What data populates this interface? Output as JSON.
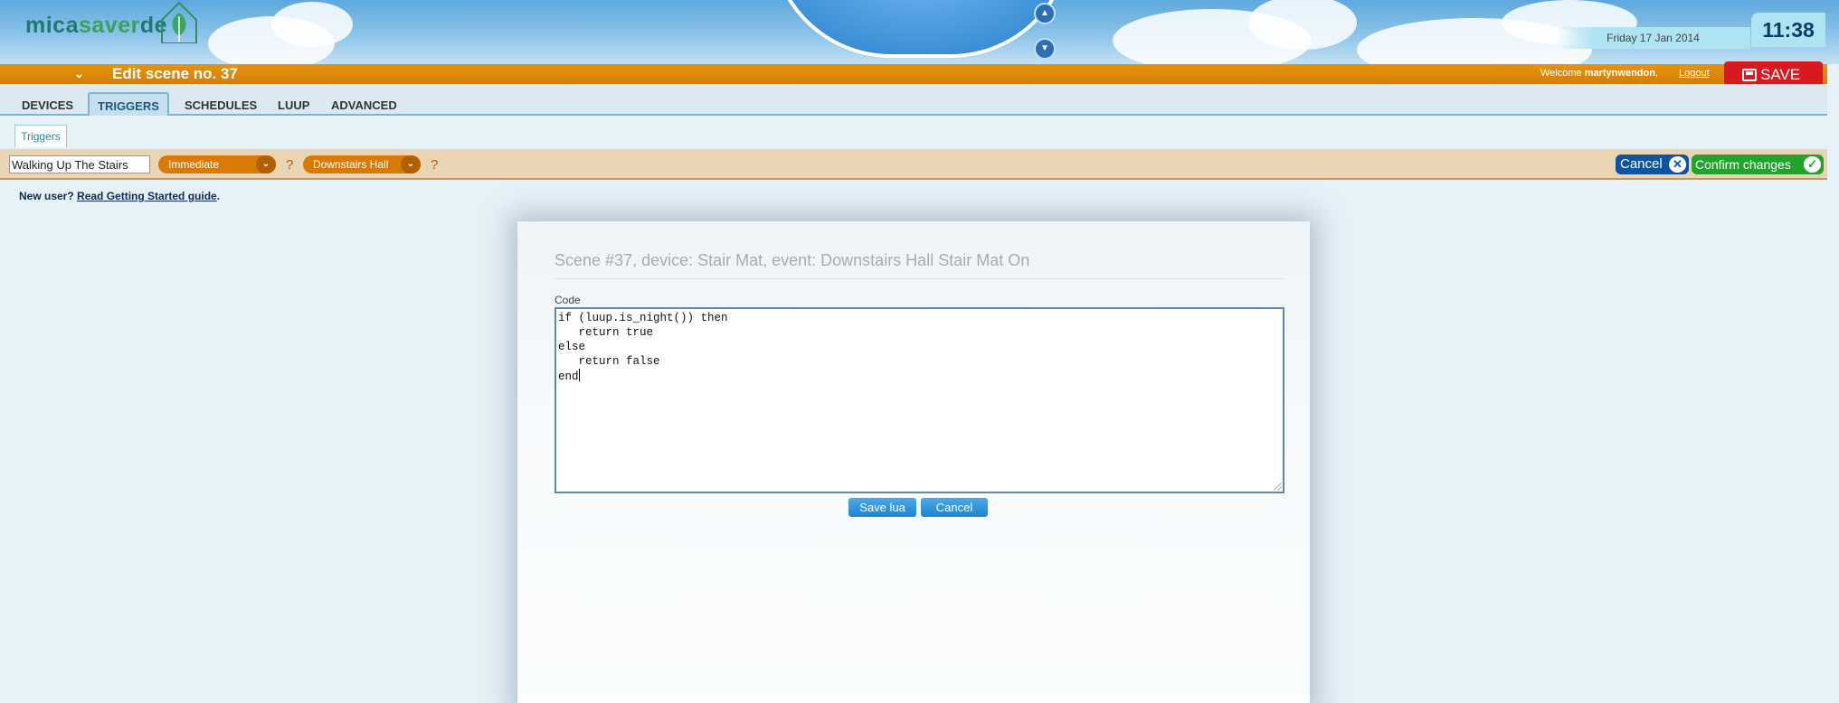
{
  "brand": {
    "logo_left": "mica",
    "logo_mid": "saver",
    "logo_right": "de"
  },
  "header": {
    "date": "Friday 17 Jan 2014",
    "time": "11:38"
  },
  "scene_bar": {
    "title": "Edit scene no. 37",
    "welcome_prefix": "Welcome",
    "username": "martynwendon",
    "welcome_suffix": ",",
    "logout": "Logout",
    "save": "SAVE"
  },
  "tabs": [
    {
      "label": "DEVICES",
      "active": false
    },
    {
      "label": "TRIGGERS",
      "active": true
    },
    {
      "label": "SCHEDULES",
      "active": false
    },
    {
      "label": "LUUP",
      "active": false
    },
    {
      "label": "ADVANCED",
      "active": false
    }
  ],
  "subtab": {
    "label": "Triggers"
  },
  "trigger_bar": {
    "name_value": "Walking Up The Stairs",
    "timing_select": "Immediate",
    "device_select": "Downstairs Hall",
    "help": "?",
    "cancel": "Cancel",
    "confirm": "Confirm changes"
  },
  "new_user": {
    "prefix": "New user?",
    "link": "Read Getting Started guide",
    "suffix": "."
  },
  "dialog": {
    "title": "Scene #37, device: Stair Mat, event: Downstairs Hall Stair Mat On",
    "code_label": "Code",
    "code_lines": [
      "if (luup.is_night()) then",
      "   return true",
      "else",
      "   return false",
      "end"
    ],
    "save_lua": "Save lua",
    "cancel": "Cancel"
  },
  "colors": {
    "orange": "#d47e06",
    "save_red": "#d71920",
    "cancel_blue": "#0d55a0",
    "confirm_green": "#22a32c",
    "button_blue": "#1f84d0"
  }
}
